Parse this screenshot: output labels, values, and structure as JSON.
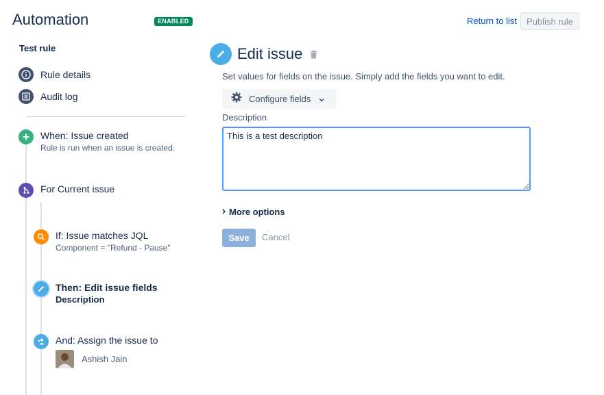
{
  "header": {
    "title": "Automation",
    "status_badge": "ENABLED",
    "return_link": "Return to list",
    "publish_button": "Publish rule"
  },
  "sidebar": {
    "rule_name": "Test rule",
    "links": [
      {
        "label": "Rule details",
        "icon": "info-icon"
      },
      {
        "label": "Audit log",
        "icon": "audit-log-icon"
      }
    ],
    "components": [
      {
        "title": "When: Issue created",
        "subtitle": "Rule is run when an issue is created.",
        "icon": "plus-icon",
        "color": "#36b37e"
      },
      {
        "title": "For Current issue",
        "subtitle": "",
        "icon": "branch-icon",
        "color": "#5e4db2"
      },
      {
        "title": "If: Issue matches JQL",
        "subtitle": "Component = \"Refund - Pause\"",
        "icon": "search-icon",
        "color": "#ff8b00"
      },
      {
        "title": "Then: Edit issue fields",
        "subtitle": "Description",
        "icon": "pencil-icon",
        "color": "#4bade8",
        "selected": true
      },
      {
        "title": "And: Assign the issue to",
        "subtitle": "Ashish Jain",
        "icon": "assign-user-icon",
        "color": "#4bade8"
      }
    ]
  },
  "main": {
    "title": "Edit issue",
    "description": "Set values for fields on the issue. Simply add the fields you want to edit.",
    "configure_button": "Configure fields",
    "field_label": "Description",
    "field_value": "This is a test description",
    "more_options": "More options",
    "save_button": "Save",
    "cancel_button": "Cancel"
  },
  "colors": {
    "accent": "#0052cc",
    "enabled": "#00875a",
    "focus": "#4c9aff"
  }
}
